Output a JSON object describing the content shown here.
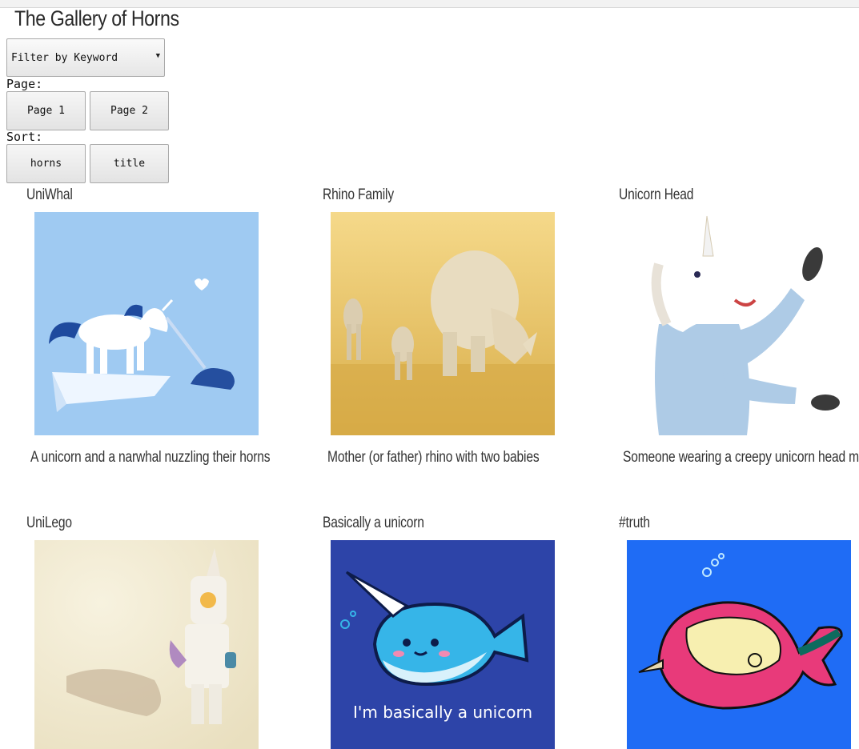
{
  "app": {
    "title": "The Gallery of Horns"
  },
  "filter": {
    "label": "Filter by Keyword"
  },
  "pager": {
    "label": "Page:",
    "buttons": [
      "Page 1",
      "Page 2"
    ]
  },
  "sorter": {
    "label": "Sort:",
    "buttons": [
      "horns",
      "title"
    ]
  },
  "gallery": [
    {
      "title": "UniWhal",
      "description": "A unicorn and a narwhal nuzzling their horns"
    },
    {
      "title": "Rhino Family",
      "description": "Mother (or father) rhino with two babies"
    },
    {
      "title": "Unicorn Head",
      "description": "Someone wearing a creepy unicorn head mas"
    },
    {
      "title": "UniLego",
      "description": ""
    },
    {
      "title": "Basically a unicorn",
      "description": "",
      "image_text": "I'm basically a unicorn"
    },
    {
      "title": "#truth",
      "description": ""
    }
  ],
  "colors": {
    "uniwhal_bg": "#9fcaf2",
    "rhino_bg": "#e7c46a",
    "basically_bg": "#2d44a8",
    "truth_bg": "#1f6cf5"
  }
}
